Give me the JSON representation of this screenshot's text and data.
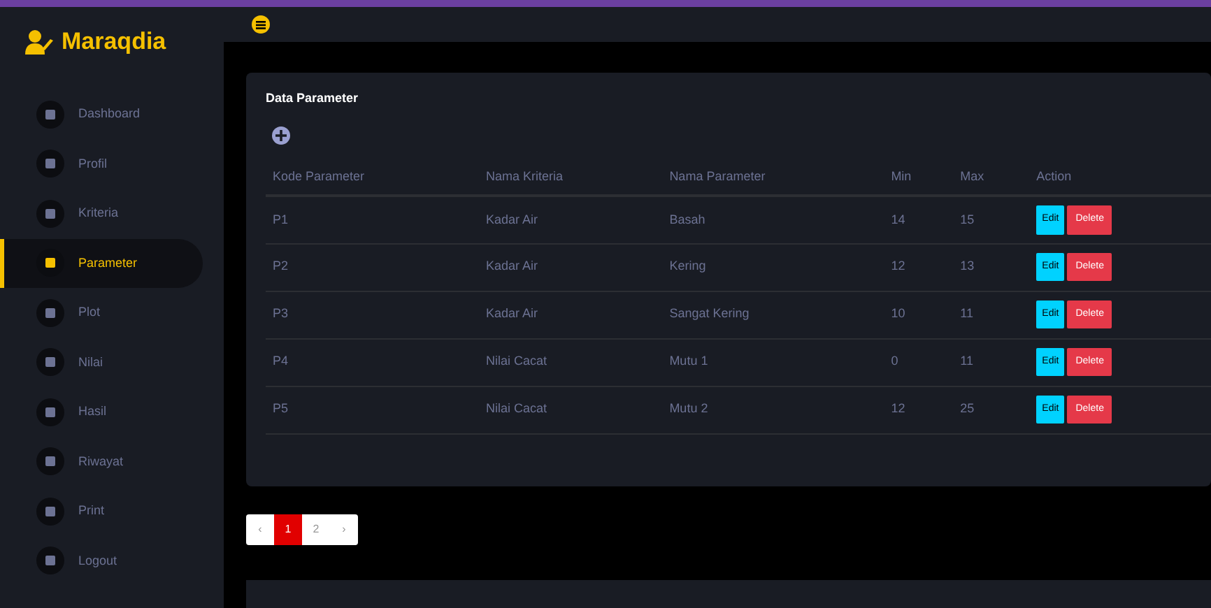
{
  "brand": "Maraqdia",
  "sidebar": {
    "items": [
      {
        "label": "Dashboard",
        "selected": false
      },
      {
        "label": "Profil",
        "selected": false
      },
      {
        "label": "Kriteria",
        "selected": false
      },
      {
        "label": "Parameter",
        "selected": true
      },
      {
        "label": "Plot",
        "selected": false
      },
      {
        "label": "Nilai",
        "selected": false
      },
      {
        "label": "Hasil",
        "selected": false
      },
      {
        "label": "Riwayat",
        "selected": false
      },
      {
        "label": "Print",
        "selected": false
      },
      {
        "label": "Logout",
        "selected": false
      }
    ]
  },
  "card": {
    "title": "Data Parameter"
  },
  "table": {
    "columns": [
      "Kode Parameter",
      "Nama Kriteria",
      "Nama Parameter",
      "Min",
      "Max",
      "Action"
    ],
    "rows": [
      {
        "cells": [
          "P1",
          "Kadar Air",
          "Basah",
          "14",
          "15"
        ],
        "actions": [
          "Edit",
          "Delete"
        ]
      },
      {
        "cells": [
          "P2",
          "Kadar Air",
          "Kering",
          "12",
          "13"
        ],
        "actions": [
          "Edit",
          "Delete"
        ]
      },
      {
        "cells": [
          "P3",
          "Kadar Air",
          "Sangat Kering",
          "10",
          "11"
        ],
        "actions": [
          "Edit",
          "Delete"
        ]
      },
      {
        "cells": [
          "P4",
          "Nilai Cacat",
          "Mutu 1",
          "0",
          "11"
        ],
        "actions": [
          "Edit",
          "Delete"
        ]
      },
      {
        "cells": [
          "P5",
          "Nilai Cacat",
          "Mutu 2",
          "12",
          "25"
        ],
        "actions": [
          "Edit",
          "Delete"
        ]
      }
    ]
  },
  "pagination": [
    {
      "label": "‹",
      "selected": false
    },
    {
      "label": "1",
      "selected": true
    },
    {
      "label": "2",
      "selected": false
    },
    {
      "label": "›",
      "selected": false
    }
  ]
}
